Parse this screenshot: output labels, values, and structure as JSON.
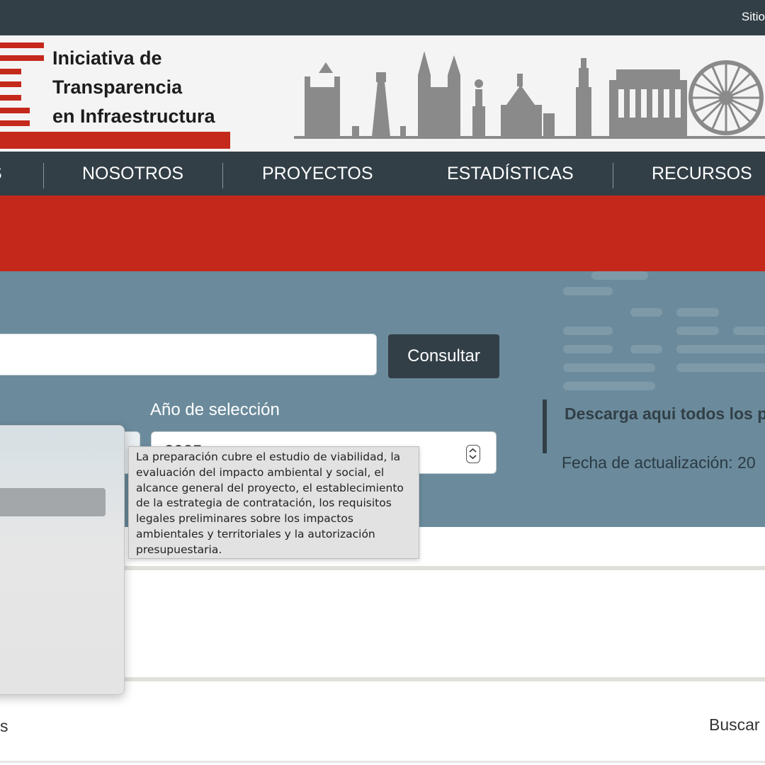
{
  "topbar": {
    "site_link": "Sitio"
  },
  "header": {
    "logo_lines": [
      "Iniciativa de",
      "Transparencia",
      "en Infraestructura"
    ],
    "brand_color": "#c4291c"
  },
  "nav": {
    "items": [
      {
        "label": "S"
      },
      {
        "label": "NOSOTROS"
      },
      {
        "label": "PROYECTOS"
      },
      {
        "label": "ESTADÍSTICAS"
      },
      {
        "label": "RECURSOS"
      }
    ]
  },
  "search": {
    "button_label": "Consultar",
    "year_label": "Año de selección",
    "year_value": "2025"
  },
  "download": {
    "title": "Descarga aqui todos los proyectos",
    "date_label": "Fecha de actualización: 20"
  },
  "tooltip": {
    "lines": [
      "La preparación cubre el estudio de viabilidad, la",
      "evaluación del impacto ambiental y social, el",
      "alcance general del proyecto, el establecimiento",
      "de la estrategia de contratación, los requisitos",
      "legales preliminares sobre los impactos",
      "ambientales y territoriales y la autorización",
      "presupuestaria."
    ]
  },
  "footer": {
    "left_fragment": "s",
    "search_label": "Buscar"
  },
  "colors": {
    "dark": "#323f47",
    "red": "#c4281b",
    "panel": "#6b8b9c"
  }
}
